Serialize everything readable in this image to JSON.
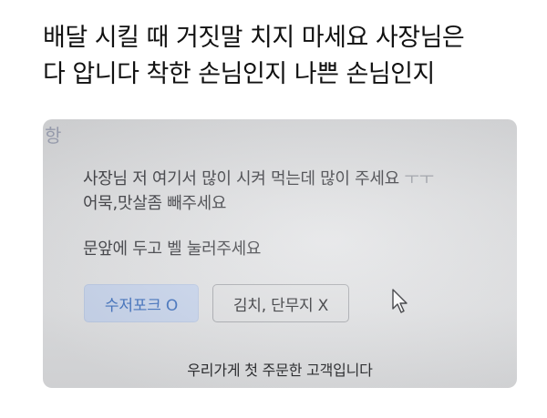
{
  "caption": {
    "line1": "배달 시킬 때 거짓말 치지 마세요 사장님은",
    "line2": "다 압니다 착한 손님인지 나쁜 손님인지"
  },
  "order_note": {
    "faded_header": "항",
    "request_main": "사장님 저 여기서 많이 시켜 먹는데 많이 주세요",
    "request_emoticon": "ㅜㅜ",
    "request_line2": "어묵,맛살좀 빼주세요",
    "delivery_request": "문앞에 두고 벨 눌러주세요",
    "option_utensils": "수저포크 O",
    "option_sides": "김치, 단무지 X",
    "customer_status": "우리가게 첫 주문한 고객입니다"
  },
  "colors": {
    "chip_blue_bg": "#c9d6ee",
    "chip_blue_text": "#3d6fbe",
    "chip_gray_bg": "#e1e2e4",
    "photo_bg": "#dfe0e2"
  },
  "icons": {
    "cursor": "mouse-pointer-icon"
  }
}
